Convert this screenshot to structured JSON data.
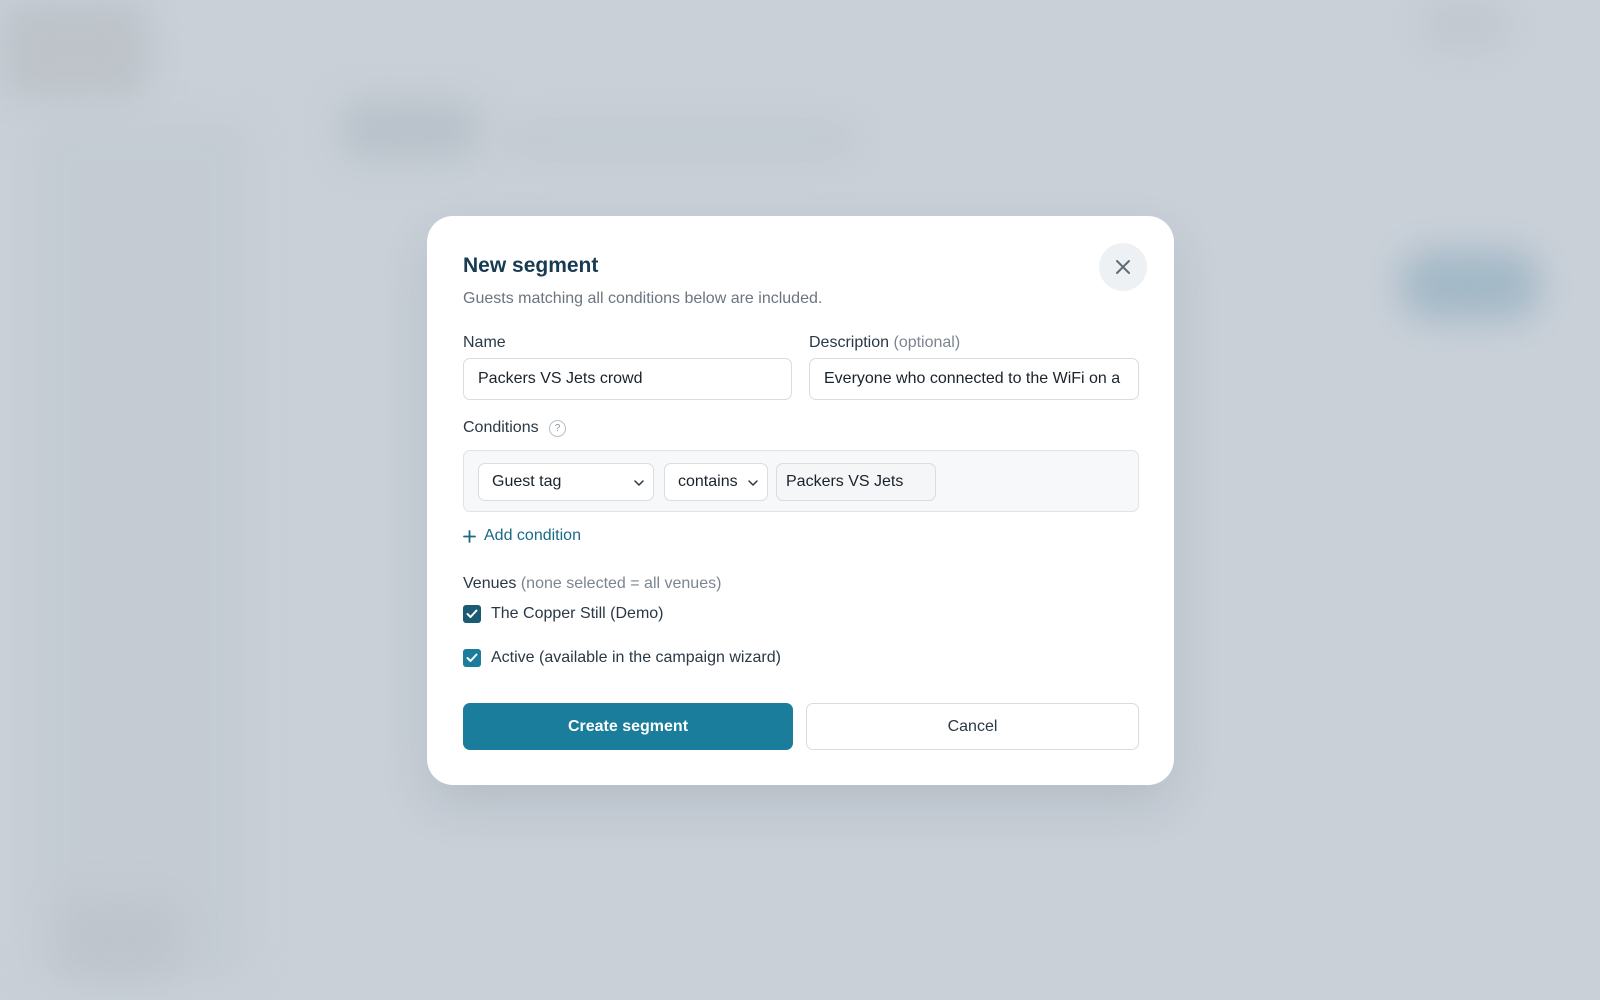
{
  "dialog": {
    "title": "New segment",
    "subtitle": "Guests matching all conditions below are included.",
    "close_icon": "close-icon"
  },
  "form": {
    "name_label": "Name",
    "name_value": "Packers VS Jets crowd",
    "description_label": "Description",
    "description_suffix": "(optional)",
    "description_value": "Everyone who connected to the WiFi on a",
    "conditions_label": "Conditions",
    "help_icon_glyph": "?",
    "conditions": [
      {
        "field": "Guest tag",
        "operator": "contains",
        "value": "Packers VS Jets"
      }
    ],
    "add_condition_label": "Add condition",
    "venues_label": "Venues",
    "venues_hint": "(none selected = all venues)",
    "venues": [
      {
        "label": "The Copper Still (Demo)",
        "checked": true
      }
    ],
    "active_label": "Active (available in the campaign wizard)",
    "active_checked": true
  },
  "actions": {
    "create_label": "Create segment",
    "cancel_label": "Cancel"
  },
  "colors": {
    "primary": "#197d9b",
    "checkbox": "#1a5a72",
    "title": "#173b52",
    "link": "#1a6a86"
  }
}
